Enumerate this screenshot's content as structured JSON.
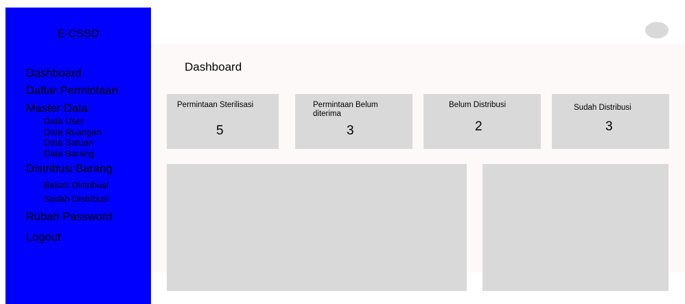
{
  "sidebar": {
    "brand": "E-CSSD",
    "items": {
      "dashboard": "Dashboard",
      "daftar_permintaan": "Daftar Permintaan",
      "master_data": {
        "label": "Master Data",
        "children": [
          "Data User",
          "Data Ruangan",
          "Data Satuan",
          "Data Barang"
        ]
      },
      "distribusi_barang": {
        "label": "Distribusi Barang",
        "children": [
          "Belum Distribusi",
          "Sudah Distribusi"
        ]
      },
      "rubah_password": "Rubah Password",
      "logout": "Logout"
    }
  },
  "main": {
    "title": "Dashboard",
    "cards": [
      {
        "label": "Permintaan Sterilisasi",
        "value": "5"
      },
      {
        "label": "Permintaan Belum diterima",
        "value": "3"
      },
      {
        "label": "Belum Distribusi",
        "value": "2"
      },
      {
        "label": "Sudah Distribusi",
        "value": "3"
      }
    ]
  },
  "colors": {
    "sidebar_bg": "#0000ff",
    "content_bg": "#fdf9f9",
    "placeholder_gray": "#d9d9d9"
  }
}
